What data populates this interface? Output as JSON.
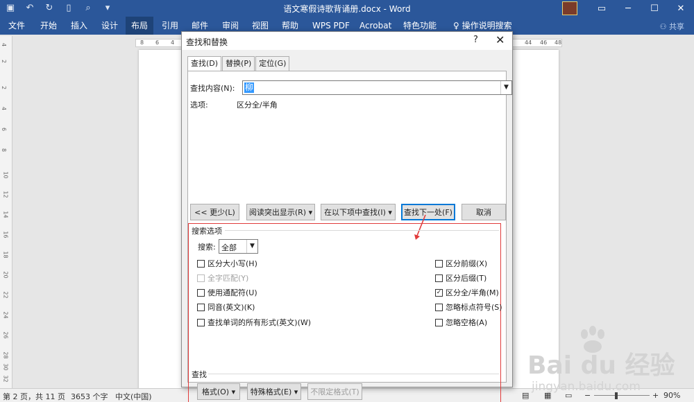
{
  "window": {
    "title": "语文寒假诗歌背诵册.docx  -  Word",
    "share": "共享",
    "colors": {
      "titlebar": "#2b579a",
      "accent": "#0078d7",
      "highlight": "#e13b3b"
    }
  },
  "ribbon": {
    "tabs": [
      "文件",
      "开始",
      "插入",
      "设计",
      "布局",
      "引用",
      "邮件",
      "审阅",
      "视图",
      "帮助",
      "WPS PDF",
      "Acrobat",
      "特色功能",
      "操作说明搜索"
    ],
    "active": "布局"
  },
  "ruler": {
    "top": [
      "8",
      "6",
      "4",
      "44",
      "46",
      "48"
    ],
    "left": [
      "4",
      "2",
      "2",
      "4",
      "6",
      "8",
      "10",
      "12",
      "14",
      "16",
      "18",
      "20",
      "22",
      "24",
      "26",
      "28",
      "30",
      "32"
    ]
  },
  "status": {
    "page": "第 2 页，共 11 页",
    "words": "3653 个字",
    "lang": "中文(中国)",
    "zoom": "90%"
  },
  "dialog": {
    "title": "查找和替换",
    "help": "?",
    "close": "✕",
    "tabs": [
      "查找(D)",
      "替换(P)",
      "定位(G)"
    ],
    "find_label": "查找内容(N):",
    "find_value": "柳",
    "options_label": "选项:",
    "options_value": "区分全/半角",
    "buttons": {
      "less": "<< 更少(L)",
      "reading_highlight": "阅读突出显示(R) ▾",
      "find_in": "在以下项中查找(I) ▾",
      "find_next": "查找下一处(F)",
      "cancel": "取消"
    },
    "search_options": {
      "label": "搜索选项",
      "search_label": "搜索:",
      "search_value": "全部",
      "left_checks": [
        {
          "label": "区分大小写(H)",
          "checked": false,
          "disabled": false
        },
        {
          "label": "全字匹配(Y)",
          "checked": false,
          "disabled": true
        },
        {
          "label": "使用通配符(U)",
          "checked": false,
          "disabled": false
        },
        {
          "label": "同音(英文)(K)",
          "checked": false,
          "disabled": false
        },
        {
          "label": "查找单词的所有形式(英文)(W)",
          "checked": false,
          "disabled": false
        }
      ],
      "right_checks": [
        {
          "label": "区分前缀(X)",
          "checked": false
        },
        {
          "label": "区分后缀(T)",
          "checked": false
        },
        {
          "label": "区分全/半角(M)",
          "checked": true
        },
        {
          "label": "忽略标点符号(S)",
          "checked": false
        },
        {
          "label": "忽略空格(A)",
          "checked": false
        }
      ]
    },
    "find_section": {
      "label": "查找",
      "format": "格式(O) ▾",
      "special": "特殊格式(E) ▾",
      "no_format": "不限定格式(T)"
    }
  },
  "watermark": {
    "brand": "Bai du 经验",
    "url": "jingyan.baidu.com"
  }
}
